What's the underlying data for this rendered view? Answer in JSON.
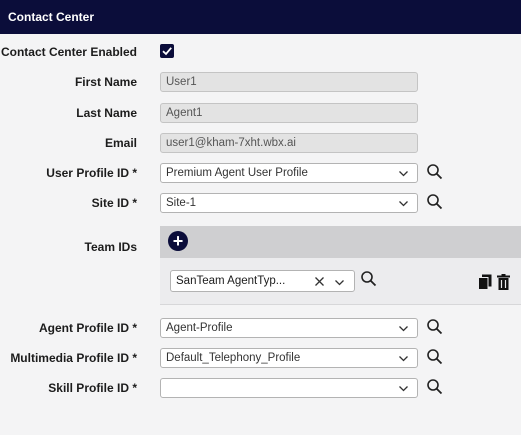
{
  "header": {
    "title": "Contact Center"
  },
  "form": {
    "contact_center_enabled": {
      "label": "Contact Center Enabled",
      "checked": true
    },
    "first_name": {
      "label": "First Name",
      "value": "User1"
    },
    "last_name": {
      "label": "Last Name",
      "value": "Agent1"
    },
    "email": {
      "label": "Email",
      "value": "user1@kham-7xht.wbx.ai"
    },
    "user_profile": {
      "label": "User Profile ID *",
      "value": "Premium Agent User Profile"
    },
    "site": {
      "label": "Site ID *",
      "value": "Site-1"
    },
    "team_ids": {
      "label": "Team IDs",
      "add_icon": "plus-icon",
      "teams": [
        {
          "value": "SanTeam AgentTyp..."
        }
      ]
    },
    "agent_profile": {
      "label": "Agent Profile ID *",
      "value": "Agent-Profile"
    },
    "multimedia_profile": {
      "label": "Multimedia Profile ID *",
      "value": "Default_Telephony_Profile"
    },
    "skill_profile": {
      "label": "Skill Profile ID *",
      "value": ""
    }
  },
  "icons": {
    "search": "search-icon",
    "chevron": "chevron-down-icon",
    "clear": "close-icon",
    "copy": "copy-icon",
    "delete": "trash-icon",
    "check": "check-icon"
  },
  "colors": {
    "brand": "#0b0d3a",
    "readonly_bg": "#e3e3e3",
    "team_bar": "#cfcfd1"
  }
}
